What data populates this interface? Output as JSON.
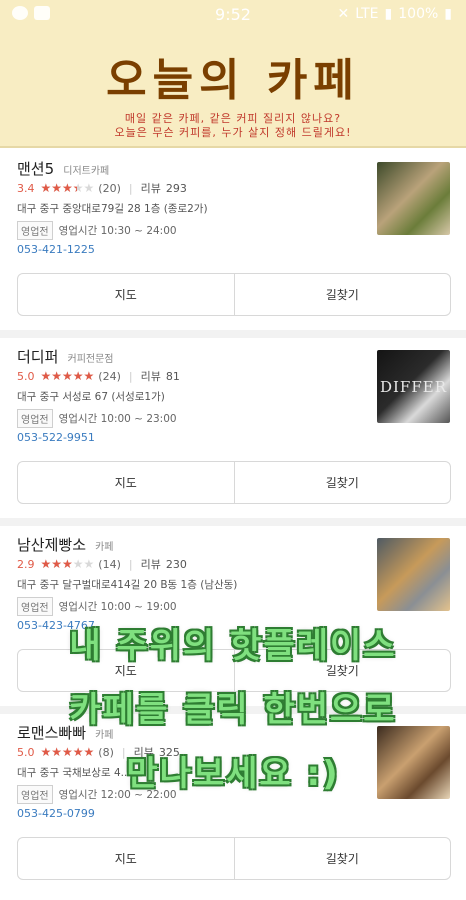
{
  "status_bar": {
    "time": "9:52",
    "network": "LTE",
    "battery": "100%"
  },
  "header": {
    "title": "오늘의 카페",
    "subtitle_line1": "매일 같은 카페, 같은 커피 질리지 않나요?",
    "subtitle_line2": "오늘은 무슨 커피를, 누가 살지 정해 드릴게요!"
  },
  "cafes": [
    {
      "name": "맨션5",
      "category": "디저트카페",
      "score": "3.4",
      "rating_fraction": 0.68,
      "review_count": "(20)",
      "review_label": "리뷰",
      "review_value": "293",
      "address": "대구 중구 중앙대로79길 28 1층 (종로2가)",
      "status": "영업전",
      "hours": "영업시간 10:30 ~ 24:00",
      "phone": "053-421-1225",
      "btn_map": "지도",
      "btn_route": "길찾기",
      "thumb_colors": [
        "#3d4a2a",
        "#b9a27a",
        "#6b7d3a",
        "#d7c8a8"
      ]
    },
    {
      "name": "더디퍼",
      "category": "커피전문점",
      "score": "5.0",
      "rating_fraction": 1.0,
      "review_count": "(24)",
      "review_label": "리뷰",
      "review_value": "81",
      "address": "대구 중구 서성로 67 (서성로1가)",
      "status": "영업전",
      "hours": "영업시간 10:00 ~ 23:00",
      "phone": "053-522-9951",
      "btn_map": "지도",
      "btn_route": "길찾기",
      "thumb_text": "DIFFER",
      "thumb_colors": [
        "#141414",
        "#2b2b2b",
        "#d9d9d9",
        "#555555"
      ]
    },
    {
      "name": "남산제빵소",
      "category": "카페",
      "score": "2.9",
      "rating_fraction": 0.58,
      "review_count": "(14)",
      "review_label": "리뷰",
      "review_value": "230",
      "address": "대구 중구 달구벌대로414길 20 B동 1층 (남산동)",
      "status": "영업전",
      "hours": "영업시간 10:00 ~ 19:00",
      "phone": "053-423-4767",
      "btn_map": "지도",
      "btn_route": "길찾기",
      "thumb_colors": [
        "#4f5a63",
        "#c79a5a",
        "#8a8f94",
        "#e3c28d"
      ]
    },
    {
      "name": "로맨스빠빠",
      "category": "카페",
      "score": "5.0",
      "rating_fraction": 1.0,
      "review_count": "(8)",
      "review_label": "리뷰",
      "review_value": "325",
      "address": "대구 중구 국채보상로 4...",
      "status": "영업전",
      "hours": "영업시간 12:00 ~ 22:00",
      "phone": "053-425-0799",
      "btn_map": "지도",
      "btn_route": "길찾기",
      "thumb_colors": [
        "#3a2a1e",
        "#c9a070",
        "#6b4a2e",
        "#e8d6b8"
      ]
    }
  ],
  "overlay": {
    "line1": "내 주위의 핫플레이스",
    "line2": "카페를 클릭 한번으로",
    "line3": "만나보세요 :)"
  },
  "colors": {
    "header_bg": "#f8edc3",
    "title": "#7a3f00",
    "subtitle": "#c0392b",
    "star": "#e05a47",
    "phone": "#3a7bbf",
    "overlay_fill": "#7fe07f",
    "overlay_stroke": "#2e7d32"
  }
}
